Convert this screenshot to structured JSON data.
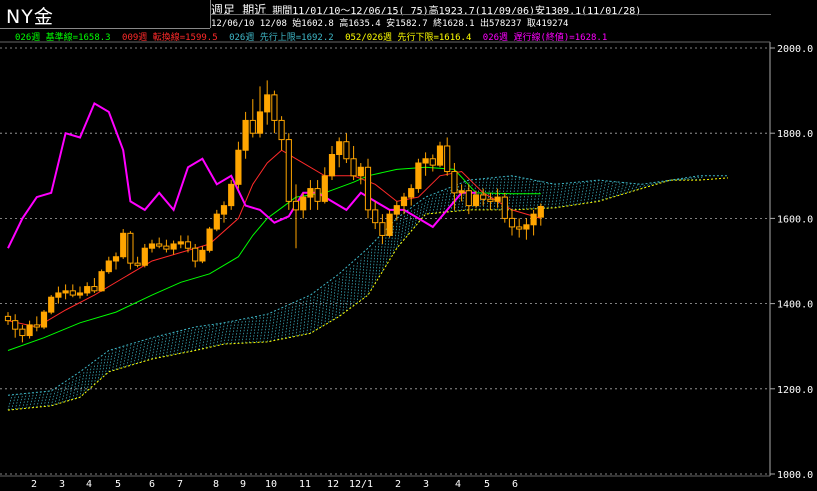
{
  "header": {
    "title": "NY金",
    "period_label": "週足 期近",
    "period_info": "期間11/01/10～12/06/15( 75)高1923.7(11/09/06)安1309.1(11/01/28)",
    "ohlc_info": "12/06/10 12/08 始1602.8 高1635.4 安1582.7 終1628.1 出578237 取419274"
  },
  "legend": [
    {
      "text": "026週 基準線=1658.3",
      "color": "#00ff00"
    },
    {
      "text": "009週 転換線=1599.5",
      "color": "#ff2a2a"
    },
    {
      "text": "026週 先行上限=1692.2",
      "color": "#3fb8c8"
    },
    {
      "text": "052/026週 先行下限=1616.4",
      "color": "#ffff00"
    },
    {
      "text": "026週 遅行線(終値)=1628.1",
      "color": "#ff00ff"
    }
  ],
  "chart_data": {
    "type": "candlestick",
    "title": "NY金",
    "y_ticks": [
      "2000.0",
      "1800.0",
      "1600.0",
      "1400.0",
      "1200.0",
      "1000.0"
    ],
    "ylim": [
      1000,
      2000
    ],
    "x_tick_labels": [
      "2",
      "3",
      "4",
      "5",
      "6",
      "7",
      "8",
      "9",
      "10",
      "11",
      "12",
      "12/1",
      "2",
      "3",
      "4",
      "5",
      "6"
    ],
    "grid": true,
    "candles": [
      [
        1370,
        1380,
        1350,
        1360
      ],
      [
        1360,
        1375,
        1320,
        1340
      ],
      [
        1340,
        1350,
        1309,
        1325
      ],
      [
        1325,
        1360,
        1318,
        1350
      ],
      [
        1350,
        1370,
        1335,
        1345
      ],
      [
        1345,
        1385,
        1340,
        1380
      ],
      [
        1380,
        1420,
        1375,
        1415
      ],
      [
        1415,
        1440,
        1400,
        1425
      ],
      [
        1425,
        1445,
        1410,
        1430
      ],
      [
        1430,
        1445,
        1415,
        1420
      ],
      [
        1420,
        1440,
        1412,
        1425
      ],
      [
        1425,
        1450,
        1418,
        1440
      ],
      [
        1440,
        1460,
        1425,
        1430
      ],
      [
        1430,
        1480,
        1428,
        1475
      ],
      [
        1475,
        1510,
        1470,
        1500
      ],
      [
        1500,
        1520,
        1480,
        1510
      ],
      [
        1510,
        1575,
        1505,
        1565
      ],
      [
        1565,
        1570,
        1480,
        1495
      ],
      [
        1495,
        1510,
        1485,
        1490
      ],
      [
        1490,
        1540,
        1485,
        1530
      ],
      [
        1530,
        1550,
        1520,
        1540
      ],
      [
        1540,
        1555,
        1530,
        1535
      ],
      [
        1535,
        1550,
        1520,
        1528
      ],
      [
        1528,
        1548,
        1515,
        1540
      ],
      [
        1540,
        1560,
        1530,
        1545
      ],
      [
        1545,
        1560,
        1520,
        1530
      ],
      [
        1530,
        1540,
        1485,
        1500
      ],
      [
        1500,
        1535,
        1495,
        1525
      ],
      [
        1525,
        1580,
        1520,
        1575
      ],
      [
        1575,
        1620,
        1570,
        1610
      ],
      [
        1610,
        1640,
        1590,
        1630
      ],
      [
        1630,
        1690,
        1620,
        1680
      ],
      [
        1680,
        1780,
        1670,
        1760
      ],
      [
        1760,
        1850,
        1740,
        1830
      ],
      [
        1830,
        1880,
        1790,
        1800
      ],
      [
        1800,
        1910,
        1790,
        1850
      ],
      [
        1850,
        1924,
        1820,
        1890
      ],
      [
        1890,
        1900,
        1800,
        1830
      ],
      [
        1830,
        1840,
        1760,
        1785
      ],
      [
        1785,
        1800,
        1620,
        1640
      ],
      [
        1640,
        1680,
        1530,
        1620
      ],
      [
        1620,
        1660,
        1600,
        1650
      ],
      [
        1650,
        1690,
        1620,
        1670
      ],
      [
        1670,
        1690,
        1620,
        1640
      ],
      [
        1640,
        1720,
        1635,
        1700
      ],
      [
        1700,
        1770,
        1690,
        1750
      ],
      [
        1750,
        1790,
        1720,
        1780
      ],
      [
        1780,
        1800,
        1730,
        1740
      ],
      [
        1740,
        1770,
        1690,
        1700
      ],
      [
        1700,
        1730,
        1680,
        1720
      ],
      [
        1720,
        1740,
        1600,
        1620
      ],
      [
        1620,
        1640,
        1575,
        1590
      ],
      [
        1590,
        1610,
        1540,
        1560
      ],
      [
        1560,
        1620,
        1555,
        1610
      ],
      [
        1610,
        1640,
        1595,
        1630
      ],
      [
        1630,
        1660,
        1610,
        1650
      ],
      [
        1650,
        1680,
        1630,
        1670
      ],
      [
        1670,
        1740,
        1660,
        1730
      ],
      [
        1730,
        1755,
        1700,
        1740
      ],
      [
        1740,
        1750,
        1710,
        1725
      ],
      [
        1725,
        1780,
        1720,
        1770
      ],
      [
        1770,
        1790,
        1700,
        1710
      ],
      [
        1710,
        1730,
        1620,
        1660
      ],
      [
        1660,
        1680,
        1640,
        1665
      ],
      [
        1665,
        1680,
        1610,
        1630
      ],
      [
        1630,
        1665,
        1625,
        1655
      ],
      [
        1655,
        1670,
        1630,
        1645
      ],
      [
        1645,
        1660,
        1620,
        1640
      ],
      [
        1640,
        1670,
        1625,
        1650
      ],
      [
        1650,
        1660,
        1590,
        1600
      ],
      [
        1600,
        1620,
        1560,
        1580
      ],
      [
        1580,
        1600,
        1555,
        1575
      ],
      [
        1575,
        1600,
        1550,
        1585
      ],
      [
        1585,
        1620,
        1560,
        1610
      ],
      [
        1603,
        1635,
        1583,
        1628
      ]
    ],
    "series": [
      {
        "name": "基準線",
        "color": "#00ff00",
        "values": [
          [
            0,
            1290
          ],
          [
            5,
            1320
          ],
          [
            10,
            1355
          ],
          [
            15,
            1380
          ],
          [
            20,
            1420
          ],
          [
            24,
            1450
          ],
          [
            28,
            1470
          ],
          [
            32,
            1510
          ],
          [
            34,
            1560
          ],
          [
            36,
            1600
          ],
          [
            38,
            1625
          ],
          [
            40,
            1650
          ],
          [
            44,
            1660
          ],
          [
            48,
            1685
          ],
          [
            50,
            1700
          ],
          [
            54,
            1715
          ],
          [
            58,
            1720
          ],
          [
            62,
            1715
          ],
          [
            65,
            1660
          ],
          [
            70,
            1658
          ],
          [
            74,
            1658
          ]
        ]
      },
      {
        "name": "転換線",
        "color": "#ff2a2a",
        "values": [
          [
            0,
            1360
          ],
          [
            4,
            1345
          ],
          [
            8,
            1385
          ],
          [
            12,
            1420
          ],
          [
            16,
            1460
          ],
          [
            20,
            1500
          ],
          [
            24,
            1520
          ],
          [
            28,
            1540
          ],
          [
            32,
            1600
          ],
          [
            34,
            1680
          ],
          [
            36,
            1730
          ],
          [
            38,
            1760
          ],
          [
            40,
            1740
          ],
          [
            44,
            1700
          ],
          [
            48,
            1700
          ],
          [
            51,
            1680
          ],
          [
            54,
            1640
          ],
          [
            57,
            1650
          ],
          [
            60,
            1700
          ],
          [
            63,
            1710
          ],
          [
            66,
            1660
          ],
          [
            70,
            1620
          ],
          [
            74,
            1600
          ]
        ]
      },
      {
        "name": "先行上限",
        "color": "#3fb8c8",
        "values": [
          [
            0,
            1185
          ],
          [
            6,
            1195
          ],
          [
            10,
            1240
          ],
          [
            14,
            1290
          ],
          [
            20,
            1320
          ],
          [
            26,
            1345
          ],
          [
            30,
            1355
          ],
          [
            36,
            1375
          ],
          [
            42,
            1420
          ],
          [
            46,
            1470
          ],
          [
            50,
            1530
          ],
          [
            54,
            1600
          ],
          [
            58,
            1650
          ],
          [
            64,
            1690
          ],
          [
            70,
            1700
          ],
          [
            76,
            1680
          ],
          [
            82,
            1690
          ],
          [
            88,
            1680
          ],
          [
            92,
            1690
          ],
          [
            96,
            1700
          ],
          [
            100,
            1700
          ]
        ]
      },
      {
        "name": "先行下限",
        "color": "#ffff00",
        "values": [
          [
            0,
            1150
          ],
          [
            6,
            1160
          ],
          [
            10,
            1180
          ],
          [
            14,
            1240
          ],
          [
            20,
            1270
          ],
          [
            26,
            1290
          ],
          [
            30,
            1305
          ],
          [
            36,
            1310
          ],
          [
            42,
            1330
          ],
          [
            46,
            1370
          ],
          [
            50,
            1420
          ],
          [
            54,
            1530
          ],
          [
            58,
            1610
          ],
          [
            64,
            1620
          ],
          [
            70,
            1620
          ],
          [
            76,
            1625
          ],
          [
            82,
            1640
          ],
          [
            88,
            1670
          ],
          [
            92,
            1690
          ],
          [
            96,
            1690
          ],
          [
            100,
            1695
          ]
        ]
      },
      {
        "name": "遅行線(終値)",
        "color": "#ff00ff",
        "values": [
          [
            0,
            1530
          ],
          [
            2,
            1600
          ],
          [
            4,
            1650
          ],
          [
            6,
            1660
          ],
          [
            8,
            1800
          ],
          [
            10,
            1790
          ],
          [
            12,
            1870
          ],
          [
            14,
            1850
          ],
          [
            16,
            1760
          ],
          [
            17,
            1640
          ],
          [
            19,
            1620
          ],
          [
            21,
            1660
          ],
          [
            23,
            1620
          ],
          [
            25,
            1720
          ],
          [
            27,
            1740
          ],
          [
            29,
            1680
          ],
          [
            31,
            1700
          ],
          [
            33,
            1630
          ],
          [
            35,
            1620
          ],
          [
            37,
            1590
          ],
          [
            39,
            1605
          ],
          [
            41,
            1660
          ],
          [
            43,
            1660
          ],
          [
            45,
            1640
          ],
          [
            47,
            1620
          ],
          [
            49,
            1660
          ],
          [
            51,
            1640
          ],
          [
            53,
            1620
          ],
          [
            55,
            1620
          ],
          [
            57,
            1600
          ],
          [
            59,
            1580
          ],
          [
            61,
            1620
          ],
          [
            63,
            1660
          ],
          [
            65,
            1660
          ]
        ]
      }
    ]
  }
}
